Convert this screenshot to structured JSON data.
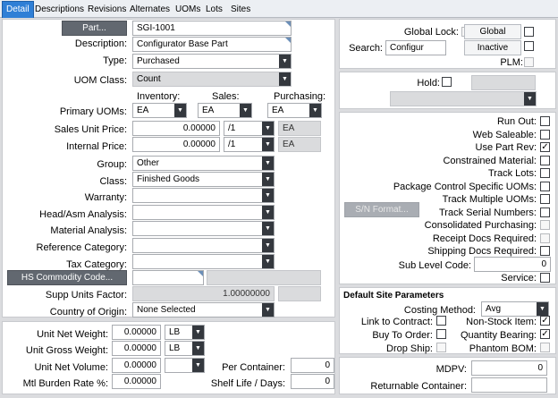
{
  "tabs": [
    "Detail",
    "Descriptions",
    "Revisions",
    "Alternates",
    "UOMs",
    "Lots",
    "Sites"
  ],
  "part": {
    "button_label": "Part...",
    "value": "SGI-1001"
  },
  "description": {
    "label": "Description:",
    "value": "Configurator Base Part"
  },
  "type": {
    "label": "Type:",
    "value": "Purchased"
  },
  "uom_class": {
    "label": "UOM Class:",
    "value": "Count"
  },
  "uom_headers": {
    "inventory": "Inventory:",
    "sales": "Sales:",
    "purchasing": "Purchasing:"
  },
  "primary_uoms": {
    "label": "Primary UOMs:",
    "inventory": "EA",
    "sales": "EA",
    "purchasing": "EA"
  },
  "sales_unit_price": {
    "label": "Sales Unit Price:",
    "value": "0.00000",
    "per": "/1",
    "uom": "EA"
  },
  "internal_price": {
    "label": "Internal Price:",
    "value": "0.00000",
    "per": "/1",
    "uom": "EA"
  },
  "group": {
    "label": "Group:",
    "value": "Other"
  },
  "class": {
    "label": "Class:",
    "value": "Finished Goods"
  },
  "warranty": {
    "label": "Warranty:",
    "value": ""
  },
  "head_asm": {
    "label": "Head/Asm Analysis:",
    "value": ""
  },
  "material_analysis": {
    "label": "Material Analysis:",
    "value": ""
  },
  "reference_category": {
    "label": "Reference Category:",
    "value": ""
  },
  "tax_category": {
    "label": "Tax Category:",
    "value": ""
  },
  "hs_commodity": {
    "button_label": "HS Commodity Code...",
    "value": ""
  },
  "supp_units_factor": {
    "label": "Supp Units Factor:",
    "value": "1.00000000"
  },
  "country_of_origin": {
    "label": "Country of Origin:",
    "value": "None Selected"
  },
  "unit_net_weight": {
    "label": "Unit Net Weight:",
    "value": "0.00000",
    "uom": "LB"
  },
  "unit_gross_weight": {
    "label": "Unit Gross Weight:",
    "value": "0.00000",
    "uom": "LB"
  },
  "unit_net_volume": {
    "label": "Unit Net Volume:",
    "value": "0.00000",
    "uom": ""
  },
  "mtl_burden_rate": {
    "label": "Mtl Burden Rate %:",
    "value": "0.00000"
  },
  "per_container": {
    "label": "Per Container:",
    "value": "0"
  },
  "shelf_life": {
    "label": "Shelf Life / Days:",
    "value": "0"
  },
  "global_lock": {
    "label": "Global Lock:",
    "checked": false
  },
  "global_button": {
    "label": "Global",
    "checked": false
  },
  "inactive_button": {
    "label": "Inactive",
    "checked": false
  },
  "search": {
    "label": "Search:",
    "value": "Configur"
  },
  "plm": {
    "label": "PLM:",
    "checked": false
  },
  "hold": {
    "label": "Hold:",
    "checked": false
  },
  "sn_format": {
    "label": "S/N Format..."
  },
  "flags": [
    {
      "label": "Run Out:",
      "checked": false,
      "enabled": true
    },
    {
      "label": "Web Saleable:",
      "checked": false,
      "enabled": true
    },
    {
      "label": "Use Part Rev:",
      "checked": true,
      "enabled": true
    },
    {
      "label": "Constrained Material:",
      "checked": false,
      "enabled": true
    },
    {
      "label": "Track Lots:",
      "checked": false,
      "enabled": true
    },
    {
      "label": "Package Control Specific UOMs:",
      "checked": false,
      "enabled": true
    },
    {
      "label": "Track Multiple UOMs:",
      "checked": false,
      "enabled": true
    },
    {
      "label": "Track Serial Numbers:",
      "checked": false,
      "enabled": true
    },
    {
      "label": "Consolidated Purchasing:",
      "checked": false,
      "enabled": false
    },
    {
      "label": "Receipt Docs Required:",
      "checked": false,
      "enabled": false
    },
    {
      "label": "Shipping Docs Required:",
      "checked": false,
      "enabled": true
    }
  ],
  "sub_level_code": {
    "label": "Sub Level Code:",
    "value": "0"
  },
  "service": {
    "label": "Service:",
    "checked": false
  },
  "site_params": {
    "title": "Default Site Parameters",
    "costing_method_label": "Costing Method:",
    "costing_method": "Avg",
    "link_to_contract": {
      "label": "Link to Contract:",
      "checked": false
    },
    "buy_to_order": {
      "label": "Buy To Order:",
      "checked": false
    },
    "drop_ship": {
      "label": "Drop Ship:",
      "checked": false
    },
    "non_stock_item": {
      "label": "Non-Stock Item:",
      "checked": true
    },
    "quantity_bearing": {
      "label": "Quantity Bearing:",
      "checked": true
    },
    "phantom_bom": {
      "label": "Phantom BOM:",
      "checked": false
    }
  },
  "mdpv": {
    "label": "MDPV:",
    "value": "0"
  },
  "returnable_container": {
    "label": "Returnable Container:",
    "value": ""
  }
}
